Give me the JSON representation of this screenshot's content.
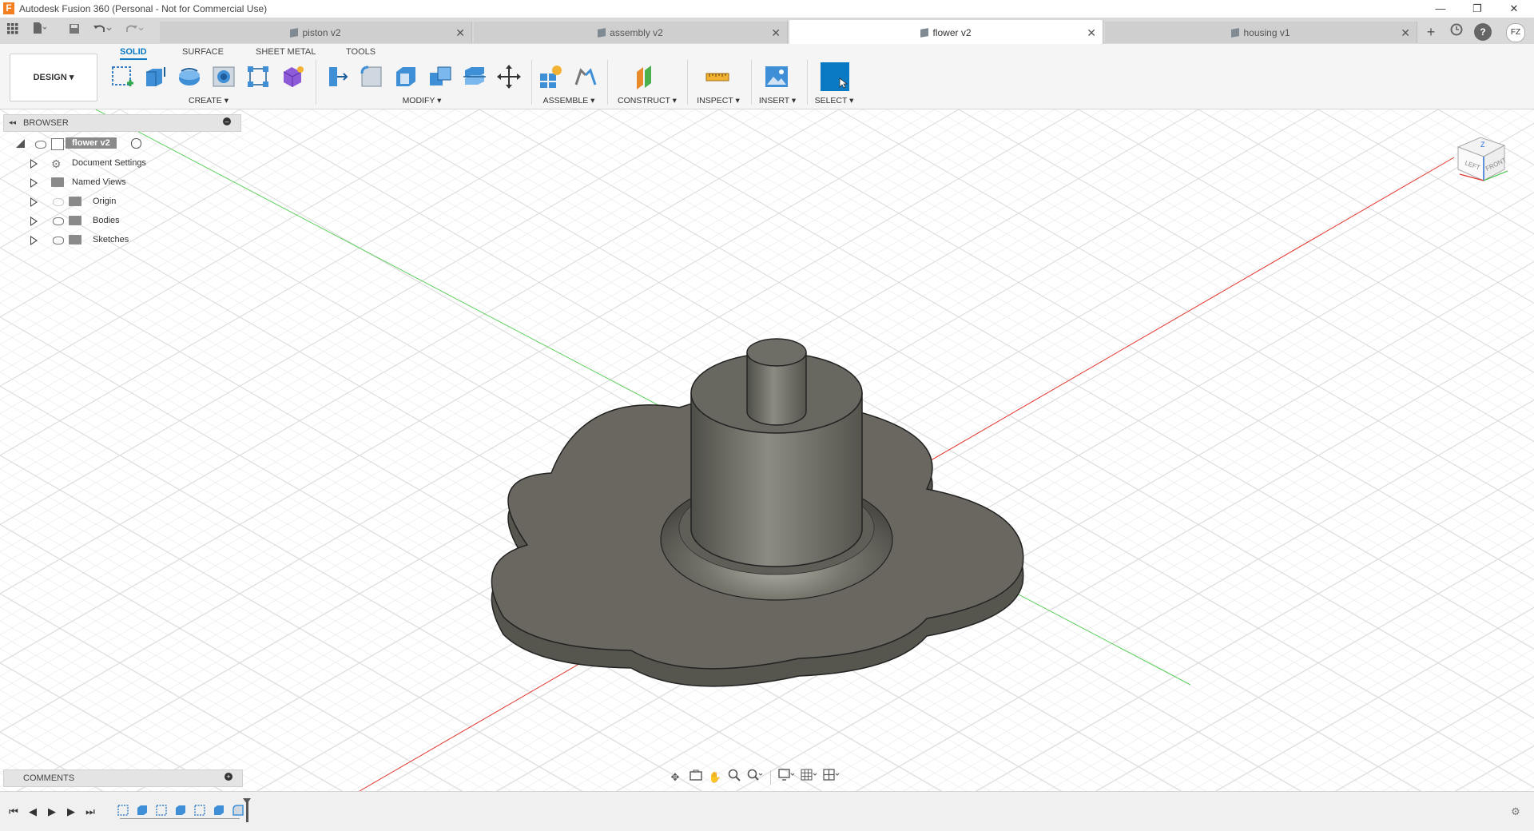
{
  "app": {
    "title": "Autodesk Fusion 360 (Personal - Not for Commercial Use)",
    "logo_letter": "F",
    "window_controls": [
      "—",
      "❐",
      "✕"
    ]
  },
  "tabs": [
    {
      "label": "piston v2",
      "active": false
    },
    {
      "label": "assembly v2",
      "active": false
    },
    {
      "label": "flower v2",
      "active": true
    },
    {
      "label": "housing v1",
      "active": false
    }
  ],
  "tabbar_right": {
    "add": "+",
    "user_initials": "FZ",
    "help": "?"
  },
  "toolbar": {
    "workspace": "DESIGN",
    "category_tabs": [
      "SOLID",
      "SURFACE",
      "SHEET METAL",
      "TOOLS"
    ],
    "groups": [
      "CREATE",
      "MODIFY",
      "ASSEMBLE",
      "CONSTRUCT",
      "INSPECT",
      "INSERT",
      "SELECT"
    ]
  },
  "browser": {
    "title": "BROWSER",
    "root": "flower v2",
    "items": [
      "Document Settings",
      "Named Views",
      "Origin",
      "Bodies",
      "Sketches"
    ]
  },
  "comments": {
    "title": "COMMENTS"
  },
  "viewcube": {
    "left": "LEFT",
    "front": "FRONT",
    "z": "Z"
  },
  "colors": {
    "accent": "#0a79c3",
    "model": "#6b6a60",
    "x_axis": "#e0332b",
    "y_axis": "#3fbf3f"
  }
}
